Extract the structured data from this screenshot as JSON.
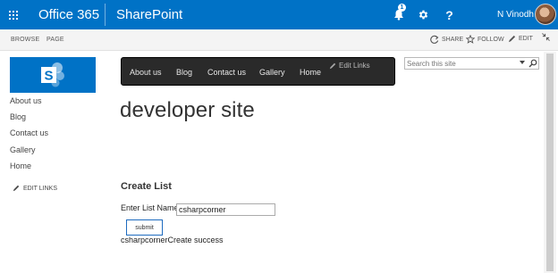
{
  "suitebar": {
    "brand": "Office 365",
    "app": "SharePoint",
    "notification_count": "1",
    "help_label": "?",
    "user_name": "N Vinodh",
    "accent": "#0072c6"
  },
  "ribbon": {
    "tabs": [
      "BROWSE",
      "PAGE"
    ],
    "share_label": "SHARE",
    "follow_label": "FOLLOW",
    "edit_label": "EDIT"
  },
  "quick_launch": {
    "items": [
      "About us",
      "Blog",
      "Contact us",
      "Gallery",
      "Home"
    ],
    "edit_links": "EDIT LINKS"
  },
  "top_nav": {
    "items": [
      "About us",
      "Blog",
      "Contact us",
      "Gallery",
      "Home"
    ],
    "edit_links": "Edit Links"
  },
  "search": {
    "placeholder": "Search this site"
  },
  "main": {
    "site_title": "developer site",
    "form_heading": "Create List",
    "list_name_label": "Enter List Name",
    "list_name_value": "csharpcorner",
    "submit_label": "submit",
    "status_message": "csharpcornerCreate success"
  }
}
